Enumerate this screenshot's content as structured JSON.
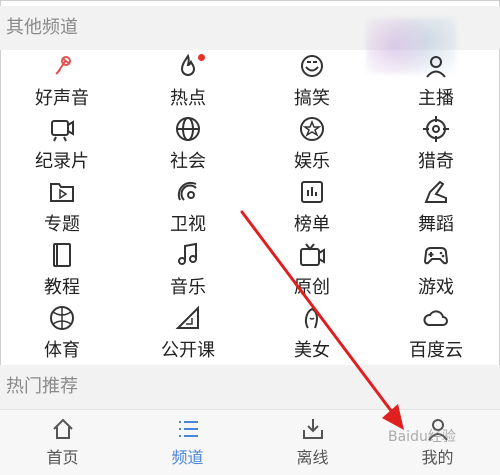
{
  "sections": {
    "other": "其他频道",
    "hot": "热门推荐"
  },
  "channels": [
    {
      "label": "好声音",
      "icon": "microphone-icon"
    },
    {
      "label": "热点",
      "icon": "flame-icon"
    },
    {
      "label": "搞笑",
      "icon": "laugh-icon"
    },
    {
      "label": "主播",
      "icon": "user-icon"
    },
    {
      "label": "纪录片",
      "icon": "camera-icon"
    },
    {
      "label": "社会",
      "icon": "globe-icon"
    },
    {
      "label": "娱乐",
      "icon": "star-icon"
    },
    {
      "label": "猎奇",
      "icon": "target-icon"
    },
    {
      "label": "专题",
      "icon": "play-folder-icon"
    },
    {
      "label": "卫视",
      "icon": "satellite-icon"
    },
    {
      "label": "榜单",
      "icon": "chart-icon"
    },
    {
      "label": "舞蹈",
      "icon": "shoe-icon"
    },
    {
      "label": "教程",
      "icon": "book-icon"
    },
    {
      "label": "音乐",
      "icon": "music-icon"
    },
    {
      "label": "原创",
      "icon": "tv-icon"
    },
    {
      "label": "游戏",
      "icon": "gamepad-icon"
    },
    {
      "label": "体育",
      "icon": "ball-icon"
    },
    {
      "label": "公开课",
      "icon": "ruler-icon"
    },
    {
      "label": "美女",
      "icon": "woman-icon"
    },
    {
      "label": "百度云",
      "icon": "cloud-icon"
    }
  ],
  "tabs": [
    {
      "label": "首页",
      "icon": "home-icon"
    },
    {
      "label": "频道",
      "icon": "list-icon"
    },
    {
      "label": "离线",
      "icon": "download-icon"
    },
    {
      "label": "我的",
      "icon": "person-icon"
    }
  ],
  "active_tab": "频道",
  "watermark": "Baidu经验",
  "colors": {
    "accent": "#4a86d8",
    "arrow": "#e02020",
    "badge": "#e6332a"
  }
}
